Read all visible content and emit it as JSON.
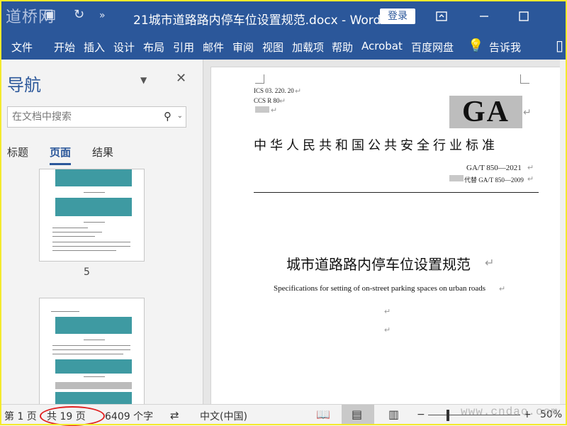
{
  "window": {
    "watermark_logo": "道桥网",
    "title": "21城市道路路内停车位设置规范.docx  -  Word",
    "login_label": "登录"
  },
  "ribbon": {
    "tabs": [
      "文件",
      "开始",
      "插入",
      "设计",
      "布局",
      "引用",
      "邮件",
      "审阅",
      "视图",
      "加载项",
      "帮助",
      "Acrobat",
      "百度网盘"
    ],
    "tell_me": "告诉我"
  },
  "nav_pane": {
    "title": "导航",
    "search_placeholder": "在文档中搜索",
    "tabs": [
      "标题",
      "页面",
      "结果"
    ],
    "active_tab": "页面",
    "thumb_page_label": "5"
  },
  "document": {
    "ics": "ICS  03. 220. 20",
    "ccs": "CCS  R  80",
    "logo": "GA",
    "standard_name": "中华人民共和国公共安全行业标准",
    "code": "GA/T 850—2021",
    "replaces": "代替 GA/T 850—2009",
    "title_cn": "城市道路路内停车位设置规范",
    "title_en": "Specifications for setting of on-street parking spaces on urban roads"
  },
  "status_bar": {
    "page": "第 1 页",
    "total_pages": "共 19 页",
    "word_count": "6409 个字",
    "language": "中文(中国)",
    "zoom": "50%",
    "watermark": "www.cndao.com"
  },
  "colors": {
    "word_blue": "#2b579a",
    "highlight_oval": "#e02020",
    "teal_figure": "#3e9aa2"
  }
}
